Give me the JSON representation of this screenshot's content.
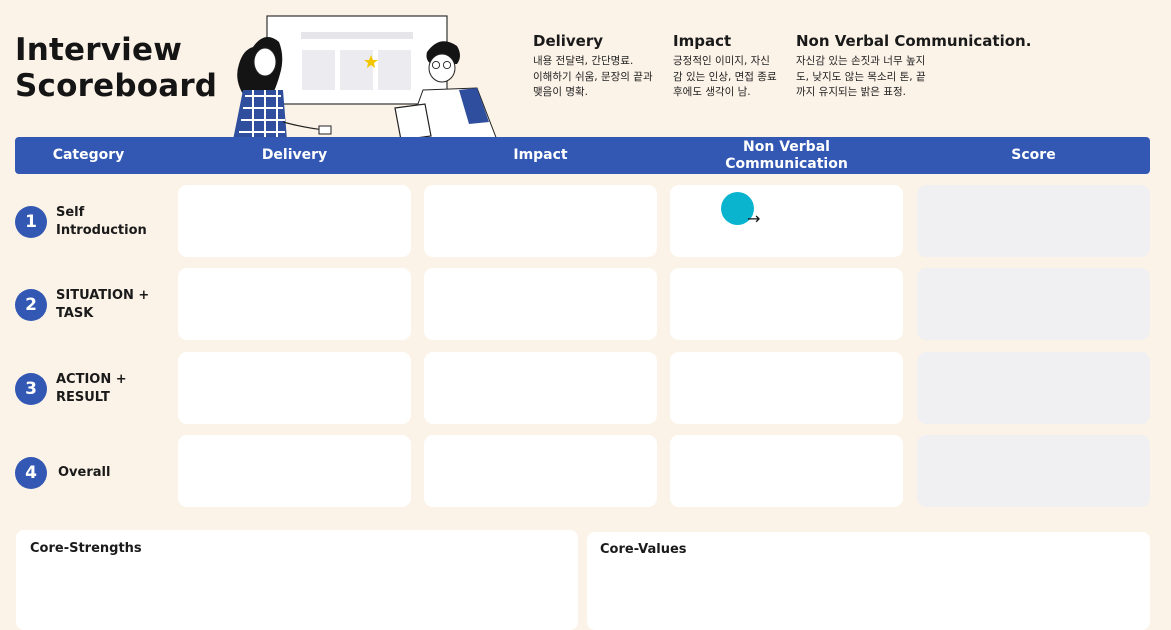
{
  "page": {
    "title_line1": "Interview",
    "title_line2": "Scoreboard"
  },
  "legend": {
    "delivery": {
      "title": "Delivery",
      "line1": "내용 전달력, 간단명료.",
      "line2": "이해하기 쉬움, 문장의 끝과",
      "line3": "맺음이 명확."
    },
    "impact": {
      "title": "Impact",
      "line1": "긍정적인 이미지, 자신",
      "line2": "감 있는 인상, 면접 종료",
      "line3": "후에도 생각이 남."
    },
    "nvc": {
      "title": "Non Verbal Communication.",
      "line1": "자신감 있는 손짓과 너무 높지",
      "line2": "도, 낮지도 않는 목소리 톤, 끝",
      "line3": "까지 유지되는 밝은 표정."
    }
  },
  "header": {
    "category": "Category",
    "delivery": "Delivery",
    "impact": "Impact",
    "nvc_line1": "Non Verbal",
    "nvc_line2": "Communication",
    "score": "Score"
  },
  "rows": [
    {
      "num": "1",
      "line1": "Self",
      "line2": "Introduction"
    },
    {
      "num": "2",
      "line1": "SITUATION +",
      "line2": "TASK"
    },
    {
      "num": "3",
      "line1": "ACTION +",
      "line2": "RESULT"
    },
    {
      "num": "4",
      "line1": "Overall",
      "line2": ""
    }
  ],
  "boxes": {
    "strengths": "Core-Strengths",
    "values": "Core-Values"
  },
  "colors": {
    "accent": "#3358b4",
    "background": "#fcf3e8",
    "cursor": "#0ab4cf"
  },
  "icons": {
    "cursor": "arrow-right-icon",
    "illustration": "two-people-presentation-illustration"
  }
}
